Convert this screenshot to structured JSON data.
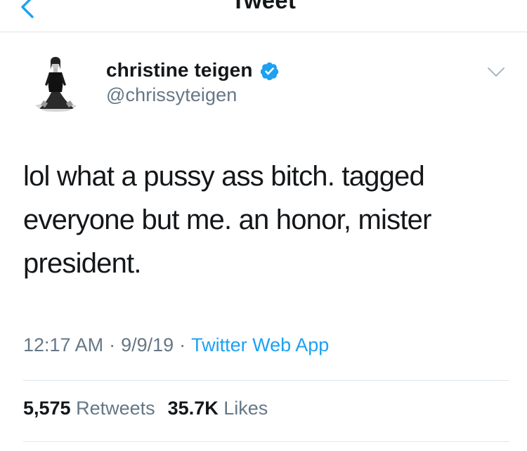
{
  "header": {
    "title": "Tweet",
    "back_icon": "chevron-left-icon"
  },
  "user": {
    "display_name": "christine teigen",
    "handle": "@chrissyteigen",
    "verified": true,
    "verified_icon": "verified-badge-icon",
    "avatar_icon": "profile-photo"
  },
  "tweet": {
    "text": "lol what a pussy ass bitch. tagged everyone but me. an honor, mister president.",
    "time": "12:17 AM",
    "date": "9/9/19",
    "separator": "·",
    "source": "Twitter Web App"
  },
  "stats": {
    "retweets_count": "5,575",
    "retweets_label": "Retweets",
    "likes_count": "35.7K",
    "likes_label": "Likes"
  },
  "colors": {
    "link": "#1da1f2",
    "secondary_text": "#657786",
    "primary_text": "#14171a",
    "divider": "#e1e8ed"
  }
}
